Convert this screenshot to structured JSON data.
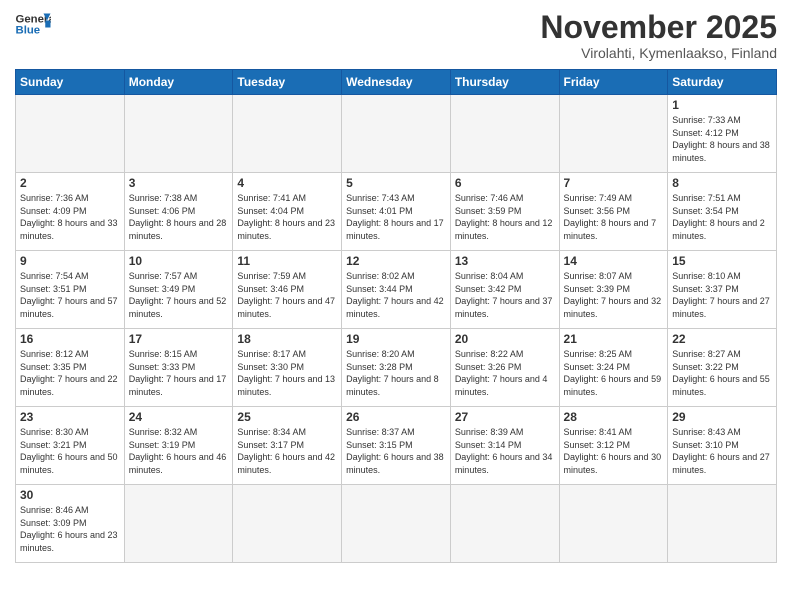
{
  "header": {
    "logo_general": "General",
    "logo_blue": "Blue",
    "month": "November 2025",
    "location": "Virolahti, Kymenlaakso, Finland"
  },
  "weekdays": [
    "Sunday",
    "Monday",
    "Tuesday",
    "Wednesday",
    "Thursday",
    "Friday",
    "Saturday"
  ],
  "weeks": [
    [
      {
        "day": "",
        "empty": true
      },
      {
        "day": "",
        "empty": true
      },
      {
        "day": "",
        "empty": true
      },
      {
        "day": "",
        "empty": true
      },
      {
        "day": "",
        "empty": true
      },
      {
        "day": "",
        "empty": true
      },
      {
        "day": "1",
        "sunrise": "Sunrise: 7:33 AM",
        "sunset": "Sunset: 4:12 PM",
        "daylight": "Daylight: 8 hours and 38 minutes."
      }
    ],
    [
      {
        "day": "2",
        "sunrise": "Sunrise: 7:36 AM",
        "sunset": "Sunset: 4:09 PM",
        "daylight": "Daylight: 8 hours and 33 minutes."
      },
      {
        "day": "3",
        "sunrise": "Sunrise: 7:38 AM",
        "sunset": "Sunset: 4:06 PM",
        "daylight": "Daylight: 8 hours and 28 minutes."
      },
      {
        "day": "4",
        "sunrise": "Sunrise: 7:41 AM",
        "sunset": "Sunset: 4:04 PM",
        "daylight": "Daylight: 8 hours and 23 minutes."
      },
      {
        "day": "5",
        "sunrise": "Sunrise: 7:43 AM",
        "sunset": "Sunset: 4:01 PM",
        "daylight": "Daylight: 8 hours and 17 minutes."
      },
      {
        "day": "6",
        "sunrise": "Sunrise: 7:46 AM",
        "sunset": "Sunset: 3:59 PM",
        "daylight": "Daylight: 8 hours and 12 minutes."
      },
      {
        "day": "7",
        "sunrise": "Sunrise: 7:49 AM",
        "sunset": "Sunset: 3:56 PM",
        "daylight": "Daylight: 8 hours and 7 minutes."
      },
      {
        "day": "8",
        "sunrise": "Sunrise: 7:51 AM",
        "sunset": "Sunset: 3:54 PM",
        "daylight": "Daylight: 8 hours and 2 minutes."
      }
    ],
    [
      {
        "day": "9",
        "sunrise": "Sunrise: 7:54 AM",
        "sunset": "Sunset: 3:51 PM",
        "daylight": "Daylight: 7 hours and 57 minutes."
      },
      {
        "day": "10",
        "sunrise": "Sunrise: 7:57 AM",
        "sunset": "Sunset: 3:49 PM",
        "daylight": "Daylight: 7 hours and 52 minutes."
      },
      {
        "day": "11",
        "sunrise": "Sunrise: 7:59 AM",
        "sunset": "Sunset: 3:46 PM",
        "daylight": "Daylight: 7 hours and 47 minutes."
      },
      {
        "day": "12",
        "sunrise": "Sunrise: 8:02 AM",
        "sunset": "Sunset: 3:44 PM",
        "daylight": "Daylight: 7 hours and 42 minutes."
      },
      {
        "day": "13",
        "sunrise": "Sunrise: 8:04 AM",
        "sunset": "Sunset: 3:42 PM",
        "daylight": "Daylight: 7 hours and 37 minutes."
      },
      {
        "day": "14",
        "sunrise": "Sunrise: 8:07 AM",
        "sunset": "Sunset: 3:39 PM",
        "daylight": "Daylight: 7 hours and 32 minutes."
      },
      {
        "day": "15",
        "sunrise": "Sunrise: 8:10 AM",
        "sunset": "Sunset: 3:37 PM",
        "daylight": "Daylight: 7 hours and 27 minutes."
      }
    ],
    [
      {
        "day": "16",
        "sunrise": "Sunrise: 8:12 AM",
        "sunset": "Sunset: 3:35 PM",
        "daylight": "Daylight: 7 hours and 22 minutes."
      },
      {
        "day": "17",
        "sunrise": "Sunrise: 8:15 AM",
        "sunset": "Sunset: 3:33 PM",
        "daylight": "Daylight: 7 hours and 17 minutes."
      },
      {
        "day": "18",
        "sunrise": "Sunrise: 8:17 AM",
        "sunset": "Sunset: 3:30 PM",
        "daylight": "Daylight: 7 hours and 13 minutes."
      },
      {
        "day": "19",
        "sunrise": "Sunrise: 8:20 AM",
        "sunset": "Sunset: 3:28 PM",
        "daylight": "Daylight: 7 hours and 8 minutes."
      },
      {
        "day": "20",
        "sunrise": "Sunrise: 8:22 AM",
        "sunset": "Sunset: 3:26 PM",
        "daylight": "Daylight: 7 hours and 4 minutes."
      },
      {
        "day": "21",
        "sunrise": "Sunrise: 8:25 AM",
        "sunset": "Sunset: 3:24 PM",
        "daylight": "Daylight: 6 hours and 59 minutes."
      },
      {
        "day": "22",
        "sunrise": "Sunrise: 8:27 AM",
        "sunset": "Sunset: 3:22 PM",
        "daylight": "Daylight: 6 hours and 55 minutes."
      }
    ],
    [
      {
        "day": "23",
        "sunrise": "Sunrise: 8:30 AM",
        "sunset": "Sunset: 3:21 PM",
        "daylight": "Daylight: 6 hours and 50 minutes."
      },
      {
        "day": "24",
        "sunrise": "Sunrise: 8:32 AM",
        "sunset": "Sunset: 3:19 PM",
        "daylight": "Daylight: 6 hours and 46 minutes."
      },
      {
        "day": "25",
        "sunrise": "Sunrise: 8:34 AM",
        "sunset": "Sunset: 3:17 PM",
        "daylight": "Daylight: 6 hours and 42 minutes."
      },
      {
        "day": "26",
        "sunrise": "Sunrise: 8:37 AM",
        "sunset": "Sunset: 3:15 PM",
        "daylight": "Daylight: 6 hours and 38 minutes."
      },
      {
        "day": "27",
        "sunrise": "Sunrise: 8:39 AM",
        "sunset": "Sunset: 3:14 PM",
        "daylight": "Daylight: 6 hours and 34 minutes."
      },
      {
        "day": "28",
        "sunrise": "Sunrise: 8:41 AM",
        "sunset": "Sunset: 3:12 PM",
        "daylight": "Daylight: 6 hours and 30 minutes."
      },
      {
        "day": "29",
        "sunrise": "Sunrise: 8:43 AM",
        "sunset": "Sunset: 3:10 PM",
        "daylight": "Daylight: 6 hours and 27 minutes."
      }
    ],
    [
      {
        "day": "30",
        "sunrise": "Sunrise: 8:46 AM",
        "sunset": "Sunset: 3:09 PM",
        "daylight": "Daylight: 6 hours and 23 minutes."
      },
      {
        "day": "",
        "empty": true
      },
      {
        "day": "",
        "empty": true
      },
      {
        "day": "",
        "empty": true
      },
      {
        "day": "",
        "empty": true
      },
      {
        "day": "",
        "empty": true
      },
      {
        "day": "",
        "empty": true
      }
    ]
  ]
}
